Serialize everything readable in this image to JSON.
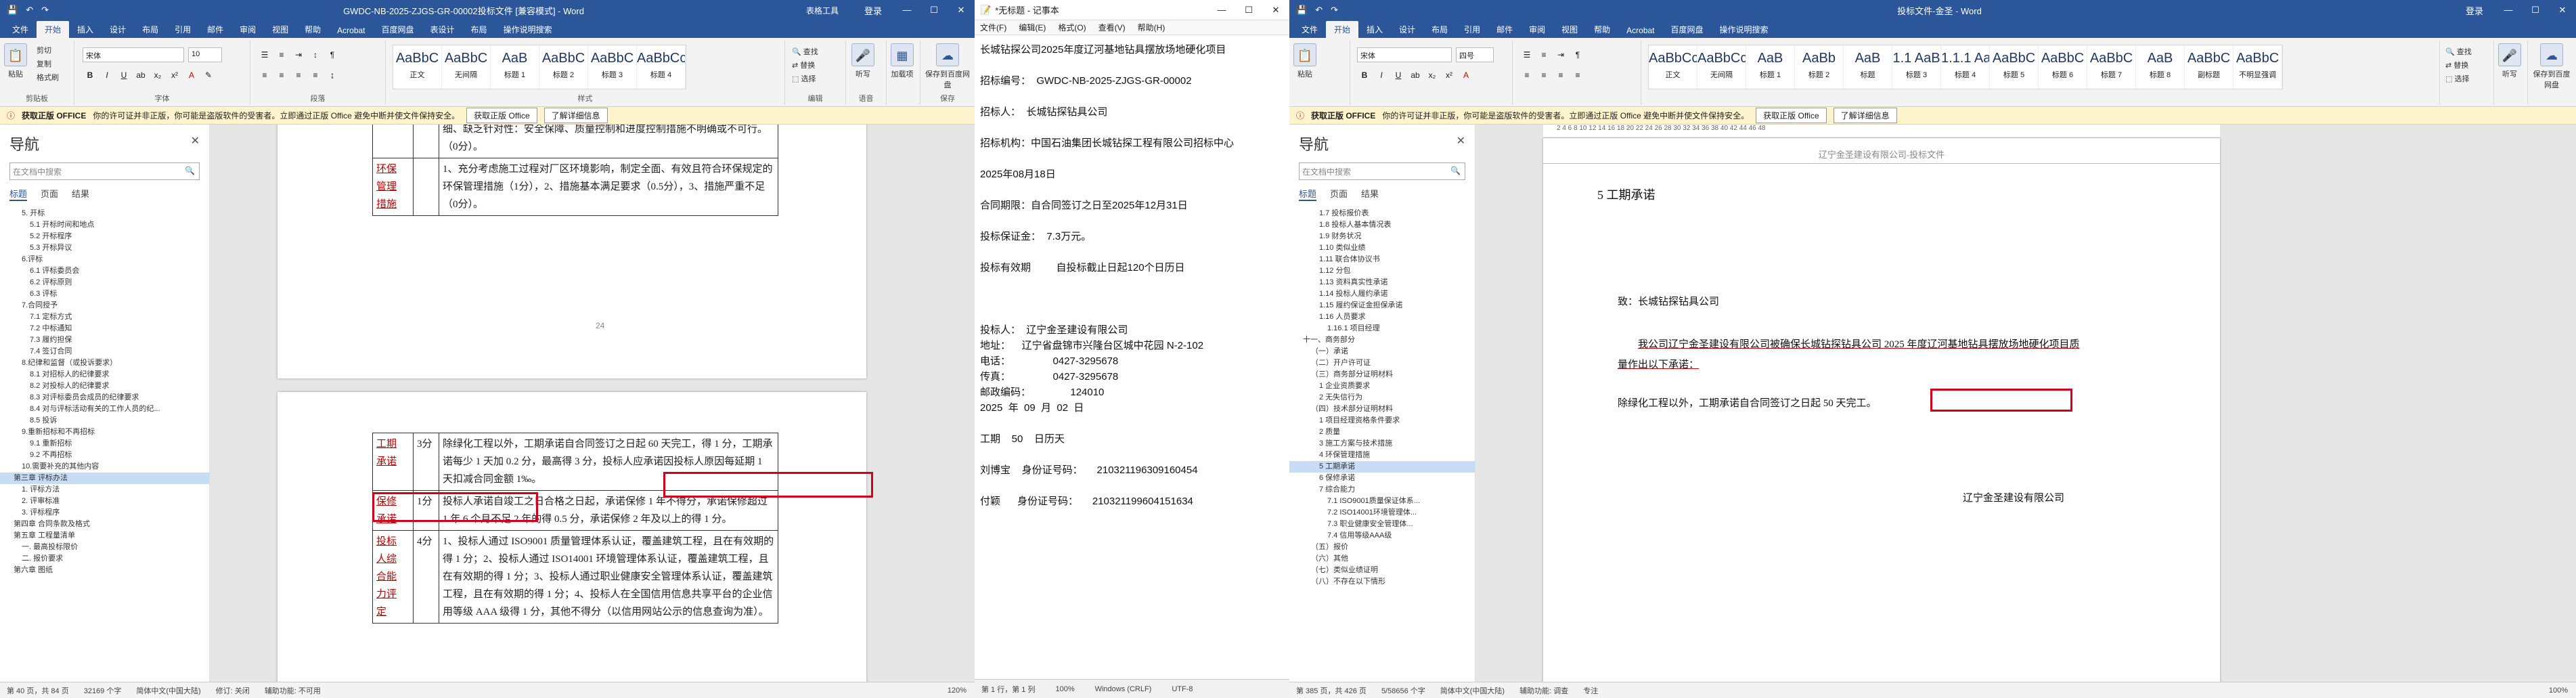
{
  "w1": {
    "title": "GWDC-NB-2025-ZJGS-GR-00002投标文件 [兼容模式] - Word",
    "table_tools": "表格工具",
    "login": "登录",
    "tabs": [
      "文件",
      "开始",
      "插入",
      "设计",
      "布局",
      "引用",
      "邮件",
      "审阅",
      "视图",
      "帮助",
      "Acrobat",
      "百度网盘",
      "表设计",
      "布局",
      "操作说明搜索"
    ],
    "ribbon": {
      "paste": "粘贴",
      "cut": "剪切",
      "copy": "复制",
      "painter": "格式刷",
      "clipboard": "剪贴板",
      "font_name": "宋体",
      "font_size": "10",
      "font_grp": "字体",
      "para_grp": "段落",
      "styles_grp": "样式",
      "edit_grp": "编辑",
      "find": "查找",
      "replace": "替换",
      "select": "选择",
      "save_baidu": "保存到百度网盘",
      "save": "保存",
      "dictate": "听写",
      "voice": "语音",
      "addin": "加载项",
      "styles": [
        {
          "s": "AaBbC",
          "n": "正文"
        },
        {
          "s": "AaBbC",
          "n": "无间隔"
        },
        {
          "s": "AaB",
          "n": "标题 1"
        },
        {
          "s": "AaBbC",
          "n": "标题 2"
        },
        {
          "s": "AaBbC",
          "n": "标题 3"
        },
        {
          "s": "AaBbCc",
          "n": "标题 4"
        }
      ]
    },
    "info": {
      "label": "获取正版 OFFICE",
      "text": "你的许可证并非正版，你可能是盗版软件的受害者。立即通过正版 Office 避免中断并使文件保持安全。",
      "btn1": "获取正版 Office",
      "btn2": "了解详细信息"
    },
    "nav": {
      "title": "导航",
      "search": "在文档中搜索",
      "tabs": [
        "标题",
        "页面",
        "结果"
      ],
      "items": [
        {
          "t": "5. 开标",
          "l": 2
        },
        {
          "t": "5.1 开标时间和地点",
          "l": 3
        },
        {
          "t": "5.2 开标程序",
          "l": 3
        },
        {
          "t": "5.3 开标异议",
          "l": 3
        },
        {
          "t": "6.评标",
          "l": 2
        },
        {
          "t": "6.1 评标委员会",
          "l": 3
        },
        {
          "t": "6.2 评标原则",
          "l": 3
        },
        {
          "t": "6.3 评标",
          "l": 3
        },
        {
          "t": "7.合同授予",
          "l": 2
        },
        {
          "t": "7.1 定标方式",
          "l": 3
        },
        {
          "t": "7.2 中标通知",
          "l": 3
        },
        {
          "t": "7.3 履约担保",
          "l": 3
        },
        {
          "t": "7.4 签订合同",
          "l": 3
        },
        {
          "t": "8.纪律和监督（或投诉要求）",
          "l": 2
        },
        {
          "t": "8.1 对招标人的纪律要求",
          "l": 3
        },
        {
          "t": "8.2 对投标人的纪律要求",
          "l": 3
        },
        {
          "t": "8.3 对评标委员会成员的纪律要求",
          "l": 3
        },
        {
          "t": "8.4 对与评标活动有关的工作人员的纪...",
          "l": 3
        },
        {
          "t": "8.5 投诉",
          "l": 3
        },
        {
          "t": "9.重新招标和不再招标",
          "l": 2
        },
        {
          "t": "9.1 重新招标",
          "l": 3
        },
        {
          "t": "9.2 不再招标",
          "l": 3
        },
        {
          "t": "10.需要补充的其他内容",
          "l": 2
        },
        {
          "t": "第三章 评标办法",
          "l": 1,
          "sel": true
        },
        {
          "t": "1. 评标方法",
          "l": 2
        },
        {
          "t": "2. 评审标准",
          "l": 2
        },
        {
          "t": "3. 评标程序",
          "l": 2
        },
        {
          "t": "第四章 合同条款及格式",
          "l": 1
        },
        {
          "t": "第五章 工程量清单",
          "l": 1
        },
        {
          "t": "一. 最高投标限价",
          "l": 2
        },
        {
          "t": "二. 报价要求",
          "l": 2
        },
        {
          "t": "第六章 图纸",
          "l": 1
        }
      ]
    },
    "page_num": "24",
    "upper_rows": [
      {
        "text": "细、缺乏针对性：安全保障、质量控制和进度控制措施不明确或不可行。（0分）。"
      },
      {
        "name_parts": [
          "环保",
          "管理",
          "措施"
        ],
        "text": "1、充分考虑施工过程对厂区环境影响，制定全面、有效且符合环保规定的环保管理措施（1分），2、措施基本满足要求（0.5分），3、措施严重不足（0分）。"
      }
    ],
    "lower_rows": [
      {
        "name": [
          "工期",
          "承诺"
        ],
        "score": "3分",
        "a": "除绿化工程以外，工期承诺自合同签订之日起 60 天完工，得 1 分，工期承诺每少 1 天加 0.2 分，最高得 3 分，",
        "b": "投标人应承诺因投标人原因每延期 1 天扣减合同金额 1‰。"
      },
      {
        "name": [
          "保修",
          "承诺"
        ],
        "score": "1分",
        "a": "投标人承诺自竣工之日合格之日起，承诺保修 1 年不得分，承诺保修超过 1 年 6 个月不足 2 年的得 0.5 分，承诺保修 2 年及以上的得 1 分。"
      },
      {
        "name": [
          "投标",
          "人综",
          "合能",
          "力评",
          "定"
        ],
        "score": "4分",
        "a": "1、投标人通过 ISO9001 质量管理体系认证，覆盖建筑工程，且在有效期的得 1 分；2、投标人通过 ISO14001 环境管理体系认证，覆盖建筑工程，且在有效期的得 1 分；3、投标人通过职业健康安全管理体系认证，覆盖建筑工程，且在有效期的得 1 分；4、投标人在全国信用信息共享平台的企业信用等级 AAA 级得 1 分，其他不得分（以信用网站公示的信息查询为准）。"
      }
    ],
    "status": {
      "page": "第 40 页，共 84 页",
      "words": "32169 个字",
      "lang": "简体中文(中国大陆)",
      "track": "修订: 关闭",
      "access": "辅助功能: 不可用",
      "zoom": "120%"
    }
  },
  "w2": {
    "title": "*无标题 - 记事本",
    "menu": [
      "文件(F)",
      "编辑(E)",
      "格式(O)",
      "查看(V)",
      "帮助(H)"
    ],
    "lines": [
      "长城钻探公司2025年度辽河基地钻具摆放场地硬化项目",
      "",
      "招标编号：  GWDC-NB-2025-ZJGS-GR-00002",
      "",
      "招标人：  长城钻探钻具公司",
      "",
      "招标机构：中国石油集团长城钻探工程有限公司招标中心",
      "",
      "2025年08月18日",
      "",
      "合同期限：自合同签订之日至2025年12月31日",
      "",
      "投标保证金：  7.3万元。",
      "",
      "投标有效期         自投标截止日起120个日历日",
      "",
      "",
      "",
      "投标人：  辽宁金圣建设有限公司",
      "地址：    辽宁省盘锦市兴隆台区城中花园 N-2-102",
      "电话：               0427-3295678",
      "传真：               0427-3295678",
      "邮政编码：              124010",
      "2025  年  09  月  02  日",
      "",
      "工期    50    日历天",
      "",
      "刘博宝    身份证号码：     210321196309160454",
      "",
      "付颖      身份证号码：     210321199604151634"
    ],
    "status": {
      "pos": "第 1 行，第 1 列",
      "zoom": "100%",
      "eol": "Windows (CRLF)",
      "enc": "UTF-8"
    }
  },
  "w3": {
    "title": "投标文件-金圣 - Word",
    "login": "登录",
    "tabs": [
      "文件",
      "开始",
      "插入",
      "设计",
      "布局",
      "引用",
      "邮件",
      "审阅",
      "视图",
      "帮助",
      "Acrobat",
      "百度网盘",
      "操作说明搜索"
    ],
    "ribbon": {
      "paste": "粘贴",
      "font_name": "宋体",
      "font_size": "四号",
      "styles": [
        {
          "s": "AaBbCcDd",
          "n": "正文"
        },
        {
          "s": "AaBbCcDd",
          "n": "无间隔"
        },
        {
          "s": "AaB",
          "n": "标题 1"
        },
        {
          "s": "AaBb",
          "n": "标题 2"
        },
        {
          "s": "AaB",
          "n": "标题"
        },
        {
          "s": "1.1 AaB",
          "n": "标题 3"
        },
        {
          "s": "1.1.1 AaB",
          "n": "标题 4"
        },
        {
          "s": "AaBbC",
          "n": "标题 5"
        },
        {
          "s": "AaBbC",
          "n": "标题 6"
        },
        {
          "s": "AaBbC",
          "n": "标题 7"
        },
        {
          "s": "AaB",
          "n": "标题 8"
        },
        {
          "s": "AaBbC",
          "n": "副标题"
        },
        {
          "s": "AaBbC",
          "n": "不明显强调"
        }
      ],
      "find": "查找",
      "replace": "替换",
      "select": "选择",
      "dictate": "听写",
      "addin": "加载项",
      "save_baidu": "保存到百度网盘"
    },
    "info": {
      "label": "获取正版 OFFICE",
      "text": "你的许可证并非正版，你可能是盗版软件的受害者。立即通过正版 Office 避免中断并使文件保持安全。",
      "btn1": "获取正版 Office",
      "btn2": "了解详细信息"
    },
    "nav": {
      "title": "导航",
      "search": "在文档中搜索",
      "tabs": [
        "标题",
        "页面",
        "结果"
      ],
      "items": [
        {
          "t": "1.7 投标报价表",
          "l": 3
        },
        {
          "t": "1.8 投标人基本情况表",
          "l": 3
        },
        {
          "t": "1.9 财务状况",
          "l": 3
        },
        {
          "t": "1.10 类似业绩",
          "l": 3
        },
        {
          "t": "1.11 联合体协议书",
          "l": 3
        },
        {
          "t": "1.12 分包",
          "l": 3
        },
        {
          "t": "1.13 资料真实性承诺",
          "l": 3
        },
        {
          "t": "1.14 投标人履约承诺",
          "l": 3
        },
        {
          "t": "1.15 履约保证金担保承诺",
          "l": 3
        },
        {
          "t": "1.16 人员要求",
          "l": 3
        },
        {
          "t": "1.16.1 项目经理",
          "l": 4
        },
        {
          "t": "十一、商务部分",
          "l": 1
        },
        {
          "t": "（一）承诺",
          "l": 2
        },
        {
          "t": "（二）开户许可证",
          "l": 2
        },
        {
          "t": "（三）商务部分证明材料",
          "l": 2
        },
        {
          "t": "1 企业资质要求",
          "l": 3
        },
        {
          "t": "2 无失信行为",
          "l": 3
        },
        {
          "t": "（四）技术部分证明材料",
          "l": 2
        },
        {
          "t": "1 项目经理资格条件要求",
          "l": 3
        },
        {
          "t": "2 质量",
          "l": 3
        },
        {
          "t": "3 施工方案与技术措施",
          "l": 3
        },
        {
          "t": "4 环保管理措施",
          "l": 3
        },
        {
          "t": "5 工期承诺",
          "l": 3,
          "sel": true
        },
        {
          "t": "6 保修承诺",
          "l": 3
        },
        {
          "t": "7 综合能力",
          "l": 3
        },
        {
          "t": "7.1 ISO9001质量保证体系...",
          "l": 4
        },
        {
          "t": "7.2 ISO14001环境管理体...",
          "l": 4
        },
        {
          "t": "7.3 职业健康安全管理体...",
          "l": 4
        },
        {
          "t": "7.4 信用等级AAA级",
          "l": 4
        },
        {
          "t": "（五）报价",
          "l": 2
        },
        {
          "t": "（六）其他",
          "l": 2
        },
        {
          "t": "（七）类似业绩证明",
          "l": 2
        },
        {
          "t": "（八）不存在以下情形",
          "l": 2
        }
      ]
    },
    "ruler": "2  4  6  8  10  12  14  16  18  20  22  24  26  28  30  32  34  36  38  40  42  44  46  48",
    "doc": {
      "header": "辽宁金圣建设有限公司-投标文件",
      "heading": "5   工期承诺",
      "to": "致：长城钻探钻具公司",
      "para1": "我公司辽宁金圣建设有限公司被确保长城钻探钻具公司 2025 年度辽河基地钻具摆放场地硬化项目质量作出以下承诺：",
      "para2": "除绿化工程以外，工期承诺自合同签订之日起 50 天完工。",
      "sign": "辽宁金圣建设有限公司"
    },
    "status": {
      "page": "第 385 页，共 426 页",
      "words": "5/58656 个字",
      "lang": "简体中文(中国大陆)",
      "access": "辅助功能: 调查",
      "focus": "专注",
      "zoom": "100%"
    }
  }
}
